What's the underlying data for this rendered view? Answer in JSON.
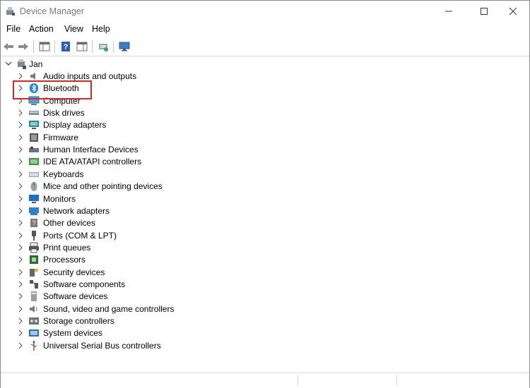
{
  "window": {
    "title": "Device Manager"
  },
  "menu": [
    "File",
    "Action",
    "View",
    "Help"
  ],
  "toolbar": [
    "back-icon",
    "forward-icon",
    "properties-pane-icon",
    "help-icon",
    "view-icon",
    "scan-hardware-icon",
    "monitor-icon"
  ],
  "tree": {
    "root": {
      "label": "Jan",
      "icon": "computer-icon",
      "expanded": true
    },
    "categories": [
      {
        "label": "Audio inputs and outputs",
        "icon": "speaker-icon"
      },
      {
        "label": "Bluetooth",
        "icon": "bluetooth-icon",
        "highlighted": true
      },
      {
        "label": "Computer",
        "icon": "computer-icon"
      },
      {
        "label": "Disk drives",
        "icon": "disk-drive-icon"
      },
      {
        "label": "Display adapters",
        "icon": "display-adapter-icon"
      },
      {
        "label": "Firmware",
        "icon": "firmware-icon"
      },
      {
        "label": "Human Interface Devices",
        "icon": "hid-icon"
      },
      {
        "label": "IDE ATA/ATAPI controllers",
        "icon": "ide-controller-icon"
      },
      {
        "label": "Keyboards",
        "icon": "keyboard-icon"
      },
      {
        "label": "Mice and other pointing devices",
        "icon": "mouse-icon"
      },
      {
        "label": "Monitors",
        "icon": "monitor-icon"
      },
      {
        "label": "Network adapters",
        "icon": "network-adapter-icon"
      },
      {
        "label": "Other devices",
        "icon": "other-device-icon"
      },
      {
        "label": "Ports (COM & LPT)",
        "icon": "port-icon"
      },
      {
        "label": "Print queues",
        "icon": "printer-icon"
      },
      {
        "label": "Processors",
        "icon": "processor-icon"
      },
      {
        "label": "Security devices",
        "icon": "security-icon"
      },
      {
        "label": "Software components",
        "icon": "software-component-icon"
      },
      {
        "label": "Software devices",
        "icon": "software-device-icon"
      },
      {
        "label": "Sound, video and game controllers",
        "icon": "sound-icon"
      },
      {
        "label": "Storage controllers",
        "icon": "storage-controller-icon"
      },
      {
        "label": "System devices",
        "icon": "system-device-icon"
      },
      {
        "label": "Universal Serial Bus controllers",
        "icon": "usb-icon"
      }
    ]
  },
  "colors": {
    "highlight_border": "#c92a2a",
    "bluetooth_blue": "#1e88e5",
    "title_gray": "#7a7a7a"
  }
}
